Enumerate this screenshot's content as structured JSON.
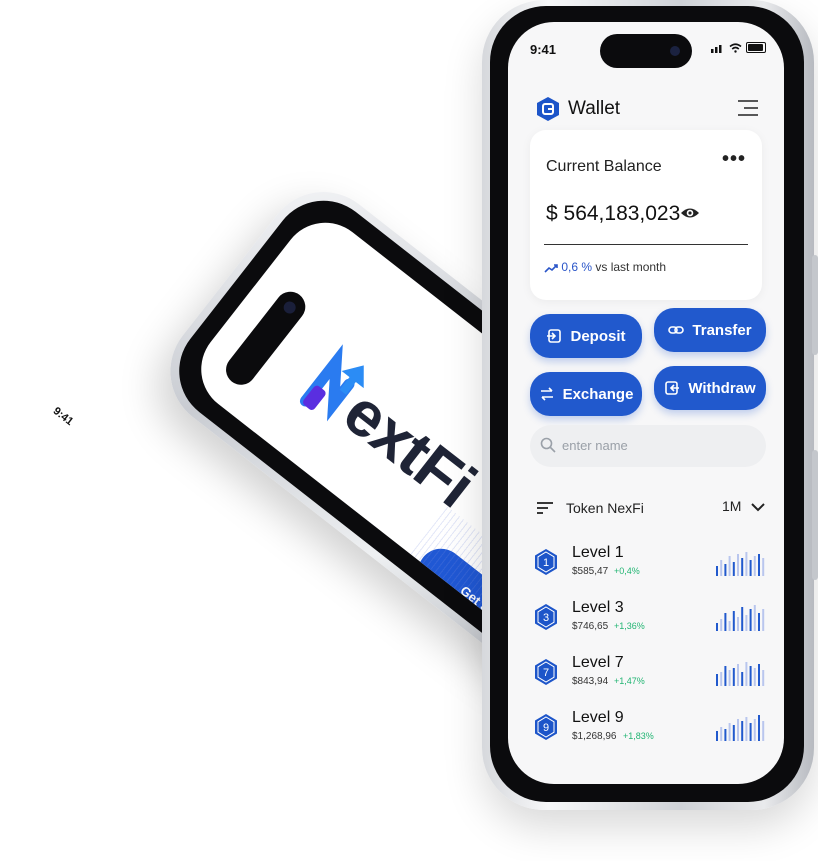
{
  "back_phone": {
    "time": "9:41",
    "brand": "extFi",
    "cta_label": "Get Started"
  },
  "front_phone": {
    "time": "9:41",
    "header": {
      "title": "Wallet"
    },
    "balance_card": {
      "label": "Current Balance",
      "amount": "$ 564,183,023",
      "change_pct": "0,6 %",
      "change_text": "vs last month"
    },
    "actions": {
      "deposit": "Deposit",
      "transfer": "Transfer",
      "exchange": "Exchange",
      "withdraw": "Withdraw"
    },
    "search": {
      "placeholder": "enter name"
    },
    "token_section": {
      "title": "Token NexFi",
      "period": "1M"
    },
    "levels": [
      {
        "num": "1",
        "name": "Level 1",
        "price": "$585,47",
        "change": "+0,4%"
      },
      {
        "num": "3",
        "name": "Level 3",
        "price": "$746,65",
        "change": "+1,36%"
      },
      {
        "num": "7",
        "name": "Level 7",
        "price": "$843,94",
        "change": "+1,47%"
      },
      {
        "num": "9",
        "name": "Level 9",
        "price": "$1,268,96",
        "change": "+1,83%"
      }
    ]
  },
  "colors": {
    "accent": "#2159cd",
    "positive": "#22b573"
  }
}
